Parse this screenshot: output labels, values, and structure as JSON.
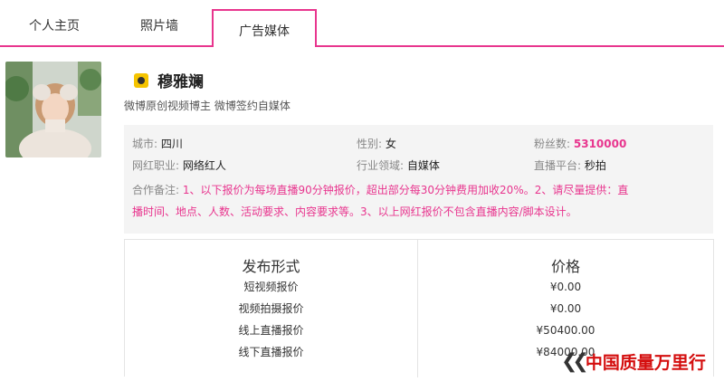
{
  "tabs": [
    {
      "label": "个人主页"
    },
    {
      "label": "照片墙"
    },
    {
      "label": "广告媒体"
    }
  ],
  "profile": {
    "name": "穆雅斓",
    "bio": "微博原创视频博主 微博签约自媒体"
  },
  "info": {
    "city_label": "城市:",
    "city": "四川",
    "gender_label": "性别:",
    "gender": "女",
    "fans_label": "粉丝数:",
    "fans": "5310000",
    "job_label": "网红职业:",
    "job": "网络红人",
    "field_label": "行业领域:",
    "field": "自媒体",
    "platform_label": "直播平台:",
    "platform": "秒拍",
    "note_label": "合作备注:",
    "note_line1": "1、以下报价为每场直播90分钟报价，超出部分每30分钟费用加收20%。2、请尽量提供：直",
    "note_line2": "播时间、地点、人数、活动要求、内容要求等。3、以上网红报价不包含直播内容/脚本设计。"
  },
  "price_table": {
    "headers": [
      "发布形式",
      "价格"
    ],
    "rows": [
      {
        "type": "短视频报价",
        "price": "¥0.00"
      },
      {
        "type": "视频拍摄报价",
        "price": "¥0.00"
      },
      {
        "type": "线上直播报价",
        "price": "¥50400.00"
      },
      {
        "type": "线下直播报价",
        "price": "¥84000.00"
      }
    ]
  },
  "watermark": "中国质量万里行",
  "colors": {
    "accent": "#e8358e",
    "watermark": "#d40e0e",
    "platform_icon": "#f5c400"
  }
}
